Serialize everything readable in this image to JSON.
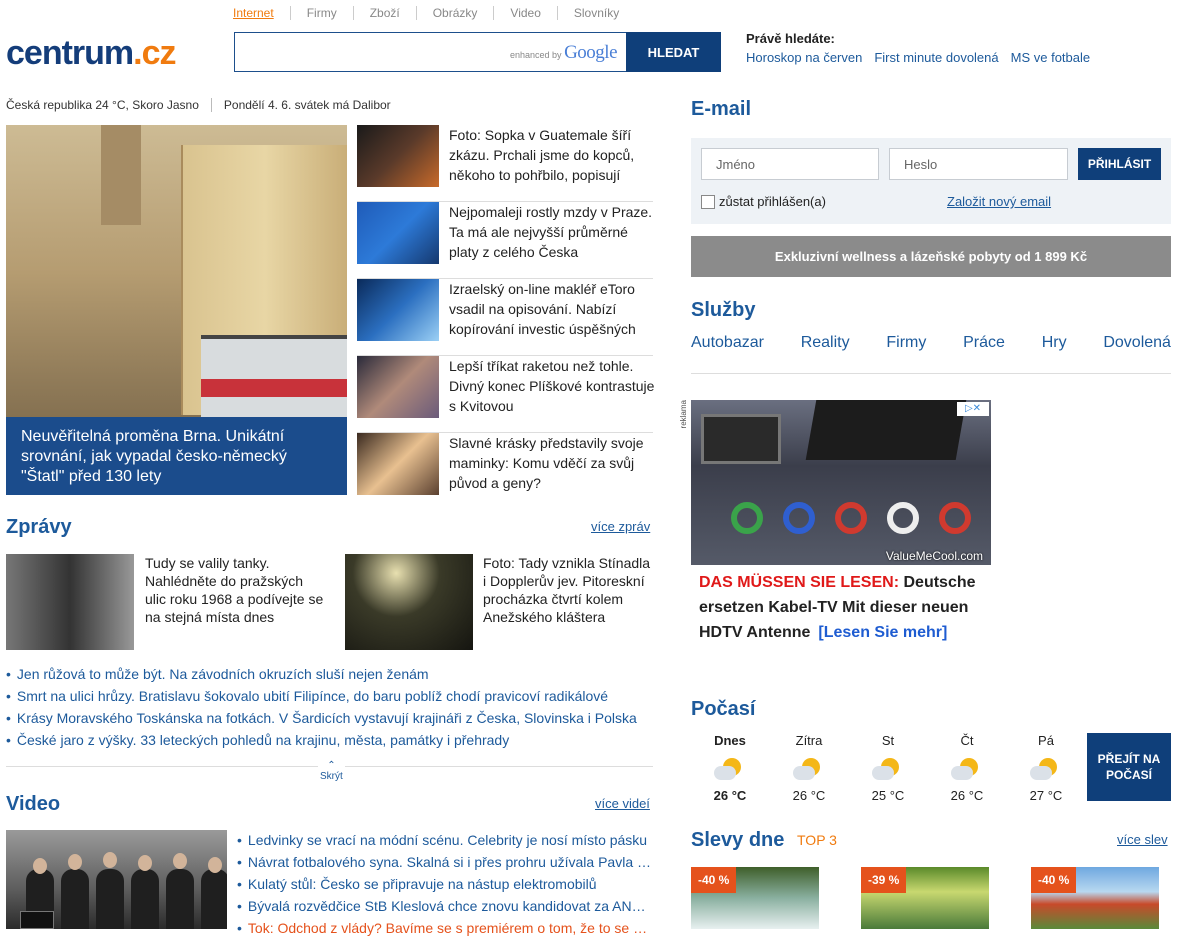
{
  "header": {
    "logo_main": "centrum",
    "logo_tld": ".cz",
    "nav": [
      "Internet",
      "Firmy",
      "Zboží",
      "Obrázky",
      "Video",
      "Slovníky"
    ],
    "search_enhanced": "enhanced by",
    "search_google": "Google",
    "search_button": "HLEDAT",
    "trending_label": "Právě hledáte:",
    "trending": [
      "Horoskop na červen",
      "First minute dovolená",
      "MS ve fotbale"
    ]
  },
  "infobar": {
    "weather": "Česká republika 24 °C, Skoro Jasno",
    "date": "Pondělí 4. 6. svátek má Dalibor"
  },
  "hero": {
    "caption": "Neuvěřitelná proměna Brna. Unikátní srovnání, jak vypadal česko-německý \"Štatl\" před 130 lety"
  },
  "news": [
    "Foto: Sopka v Guatemale šíří zkázu. Prchali jsme do kopců, někoho to pohřbilo, popisují",
    "Nejpomaleji rostly mzdy v Praze. Ta má ale nejvyšší průměrné platy z celého Česka",
    "Izraelský on-line makléř eToro vsadil na opisování. Nabízí kopírování investic úspěšných",
    "Lepší tříkat raketou než tohle. Divný konec Plíškové kontrastuje s Kvitovou",
    "Slavné krásky představily svoje maminky: Komu vděčí za svůj původ a geny?"
  ],
  "zpravy": {
    "title": "Zprávy",
    "more": "více zpráv",
    "feature1": "Tudy se valily tanky. Nahlédněte do pražských ulic roku 1968 a podívejte se na stejná místa dnes",
    "feature2": "Foto: Tady vznikla Stínadla i Dopplerův jev. Pitoreskní procházka čtvrtí kolem Anežského kláštera",
    "list": [
      "Jen růžová to může být. Na závodních okruzích sluší nejen ženám",
      "Smrt na ulici hrůzy. Bratislavu šokovalo ubití Filipínce, do baru poblíž chodí pravicoví radikálové",
      "Krásy Moravského Toskánska na fotkách. V Šardicích vystavují krajináři z Česka, Slovinska i Polska",
      "České jaro z výšky. 33 leteckých pohledů na krajinu, města, památky i přehrady"
    ],
    "hide": "Skrýt"
  },
  "video": {
    "title": "Video",
    "more": "více videí",
    "list": [
      "Ledvinky se vrací na módní scénu. Celebrity je nosí místo pásku",
      "Návrat fotbalového syna. Skalná si i přes prohru užívala Pavla Nedvěda",
      "Kulatý stůl: Česko se připravuje na nástup elektromobilů",
      "Bývalá rozvědčice StB Kleslová chce znovu kandidovat za ANO do Senátu",
      "Tok: Odchod z vlády? Bavíme se s premiérem o tom, že to se sociální demokracií"
    ]
  },
  "email": {
    "title": "E-mail",
    "name_placeholder": "Jméno",
    "pass_placeholder": "Heslo",
    "login": "PŘIHLÁSIT",
    "stay": "zůstat přihlášen(a)",
    "new": "Založit nový email"
  },
  "wellness": "Exkluzivní wellness a lázeňské pobyty od 1 899 Kč",
  "sluzby": {
    "title": "Služby",
    "items": [
      "Autobazar",
      "Reality",
      "Firmy",
      "Práce",
      "Hry",
      "Dovolená"
    ]
  },
  "ad": {
    "label": "reklama",
    "brand": "ValueMeCool.com",
    "red": "DAS MÜSSEN SIE LESEN:",
    "text": "Deutsche ersetzen Kabel-TV Mit dieser neuen HDTV Antenne",
    "more": "[Lesen Sie mehr]"
  },
  "pocasi": {
    "title": "Počasí",
    "days": [
      {
        "day": "Dnes",
        "temp": "26 °C"
      },
      {
        "day": "Zítra",
        "temp": "26 °C"
      },
      {
        "day": "St",
        "temp": "25 °C"
      },
      {
        "day": "Čt",
        "temp": "26 °C"
      },
      {
        "day": "Pá",
        "temp": "27 °C"
      }
    ],
    "button": "PŘEJÍT NA POČASÍ"
  },
  "slevy": {
    "title": "Slevy dne",
    "top": "TOP 3",
    "more": "více slev",
    "deals": [
      "-40 %",
      "-39 %",
      "-40 %"
    ]
  }
}
